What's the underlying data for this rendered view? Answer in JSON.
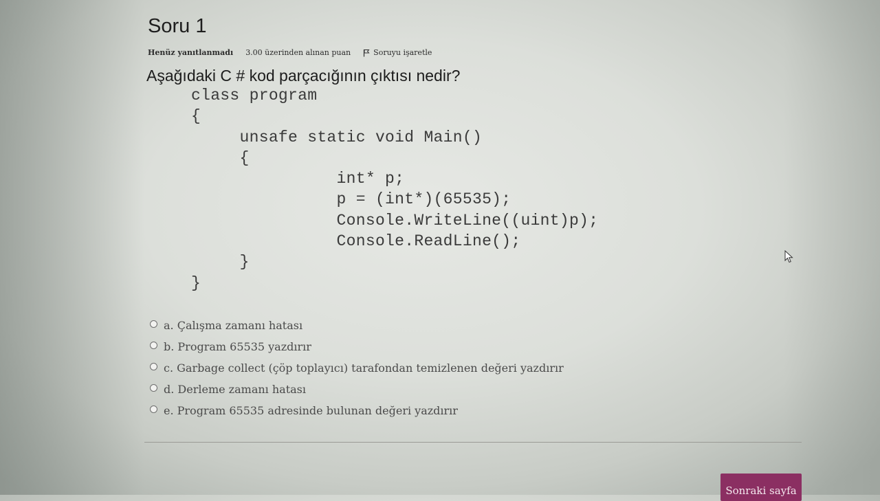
{
  "question": {
    "title": "Soru 1",
    "status": "Henüz yanıtlanmadı",
    "points": "3.00 üzerinden alınan puan",
    "flag_label": "Soruyu işaretle",
    "text": "Aşağıdaki C # kod parçacığının çıktısı nedir?",
    "code": "class program\n{\n     unsafe static void Main()\n     {\n               int* p;\n               p = (int*)(65535);\n               Console.WriteLine((uint)p);\n               Console.ReadLine();\n     }\n}"
  },
  "answers": [
    {
      "label": "a. Çalışma zamanı hatası"
    },
    {
      "label": "b. Program 65535 yazdırır"
    },
    {
      "label": "c. Garbage collect (çöp toplayıcı) tarafondan temizlenen değeri yazdırır"
    },
    {
      "label": "d. Derleme zamanı hatası"
    },
    {
      "label": "e. Program 65535 adresinde bulunan değeri yazdırır"
    }
  ],
  "navigation": {
    "next_label": "Sonraki sayfa"
  },
  "colors": {
    "accent": "#8b2f62"
  },
  "icons": {
    "flag": "flag-icon",
    "cursor": "mouse-pointer-icon"
  }
}
